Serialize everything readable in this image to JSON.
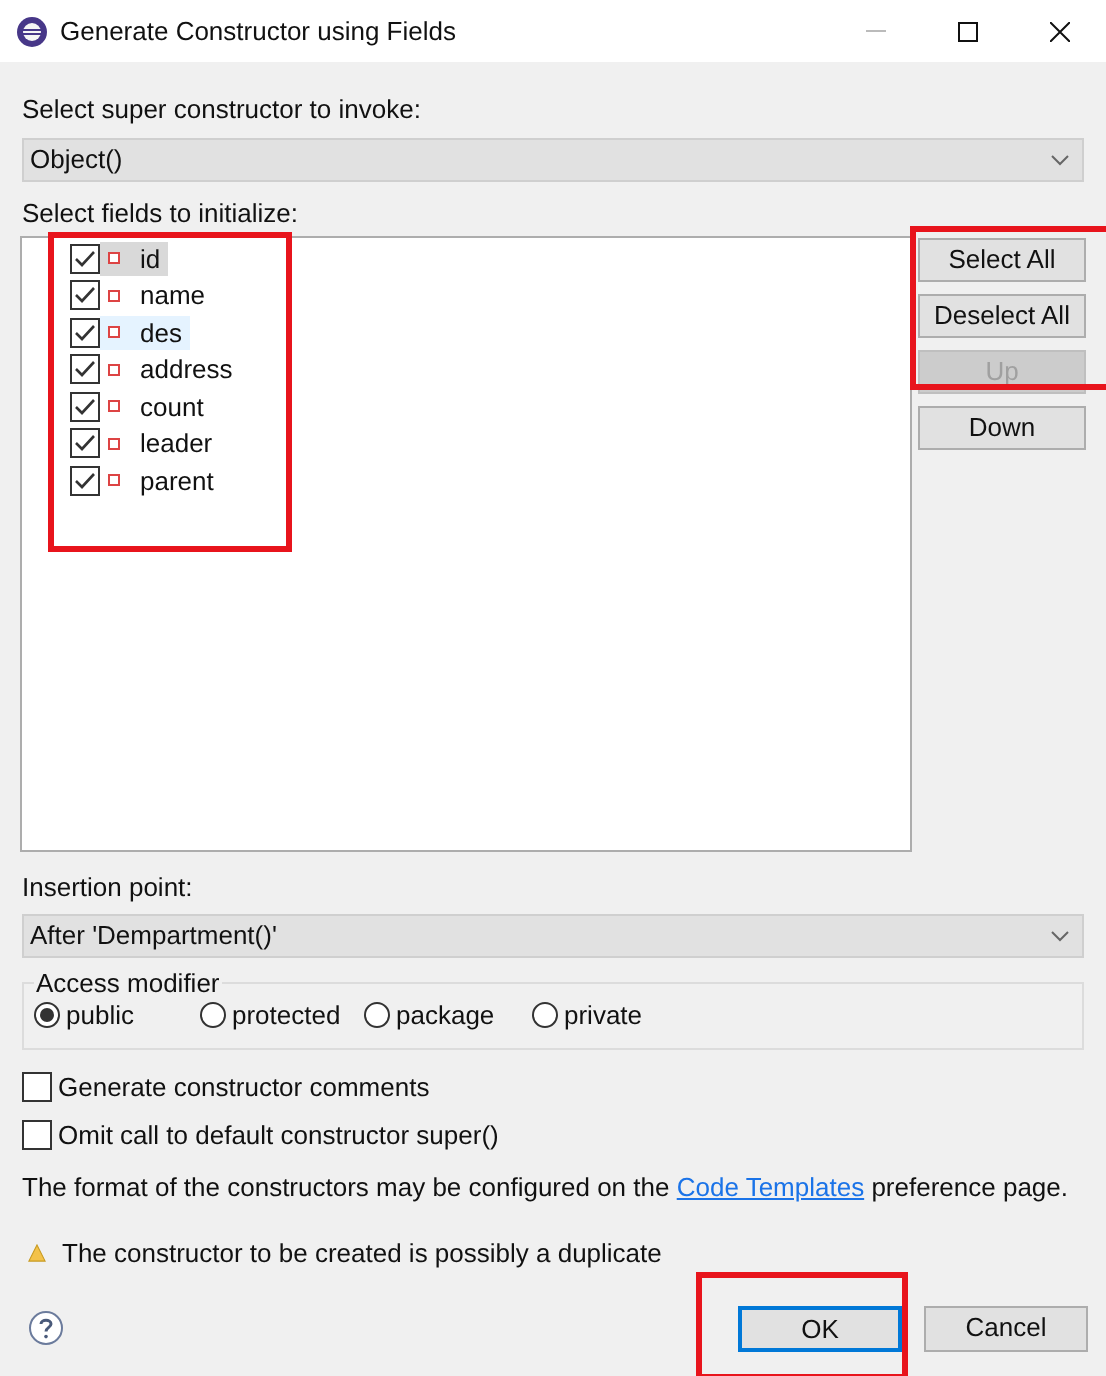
{
  "window": {
    "title": "Generate Constructor using Fields"
  },
  "super_constructor": {
    "label": "Select super constructor to invoke:",
    "value": "Object()"
  },
  "fields": {
    "label": "Select fields to initialize:",
    "items": [
      {
        "name": "id",
        "checked": true,
        "selected": true,
        "hovered": false
      },
      {
        "name": "name",
        "checked": true,
        "selected": false,
        "hovered": false
      },
      {
        "name": "des",
        "checked": true,
        "selected": false,
        "hovered": true
      },
      {
        "name": "address",
        "checked": true,
        "selected": false,
        "hovered": false
      },
      {
        "name": "count",
        "checked": true,
        "selected": false,
        "hovered": false
      },
      {
        "name": "leader",
        "checked": true,
        "selected": false,
        "hovered": false
      },
      {
        "name": "parent",
        "checked": true,
        "selected": false,
        "hovered": false
      }
    ]
  },
  "side_buttons": [
    {
      "label": "Select All",
      "disabled": false
    },
    {
      "label": "Deselect All",
      "disabled": false
    },
    {
      "label": "Up",
      "disabled": true
    },
    {
      "label": "Down",
      "disabled": false
    }
  ],
  "insertion_point": {
    "label": "Insertion point:",
    "value": "After 'Dempartment()'"
  },
  "access_modifier": {
    "label": "Access modifier",
    "options": [
      {
        "label": "public",
        "selected": true
      },
      {
        "label": "protected",
        "selected": false
      },
      {
        "label": "package",
        "selected": false
      },
      {
        "label": "private",
        "selected": false
      }
    ]
  },
  "options": [
    {
      "label": "Generate constructor comments",
      "checked": false
    },
    {
      "label": "Omit call to default constructor super()",
      "checked": false
    }
  ],
  "info": {
    "before": "The format of the constructors may be configured on the",
    "link": "Code Templates",
    "after": "preference page."
  },
  "warning": "The constructor to be created is possibly a duplicate",
  "buttons": [
    {
      "label": "OK",
      "default": true
    },
    {
      "label": "Cancel",
      "default": false
    }
  ],
  "highlights": [
    {
      "kind": "fields"
    },
    {
      "kind": "side_buttons"
    },
    {
      "kind": "ok_button"
    }
  ]
}
